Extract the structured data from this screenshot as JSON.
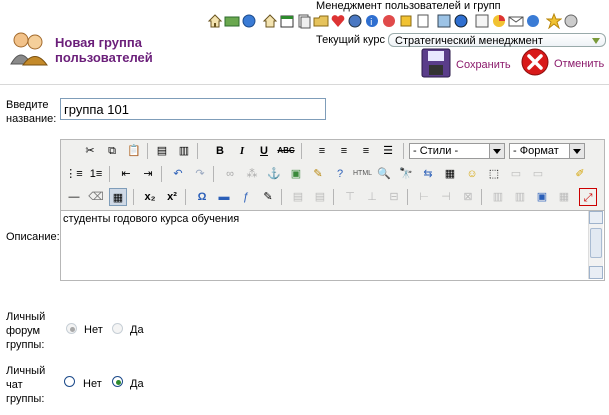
{
  "top_bar": {
    "module_title": "Менеджмент пользователей и групп",
    "course_label": "Текущий курс",
    "course_value": "Стратегический менеджмент"
  },
  "header": {
    "title_line1": "Новая группа",
    "title_line2": "пользователей",
    "save_label": "Сохранить",
    "cancel_label": "Отменить"
  },
  "form": {
    "name_label_line1": "Введите",
    "name_label_line2": "название:",
    "name_value": "группа 101",
    "description_label": "Описание:",
    "description_value": "студенты годового курса обучения",
    "styles_select": "- Стили -",
    "format_select": "- Формат",
    "forum_label_line1": "Личный",
    "forum_label_line2": "форум",
    "forum_label_line3": "группы:",
    "chat_label_line1": "Личный",
    "chat_label_line2": "чат",
    "chat_label_line3": "группы:",
    "no_label": "Нет",
    "yes_label": "Да"
  },
  "state": {
    "forum_selected": "Нет",
    "forum_disabled": true,
    "chat_selected": "Да"
  },
  "colors": {
    "title": "#6b1f7a",
    "button_label": "#8b1a6b",
    "cancel_icon": "#d81a1a"
  }
}
